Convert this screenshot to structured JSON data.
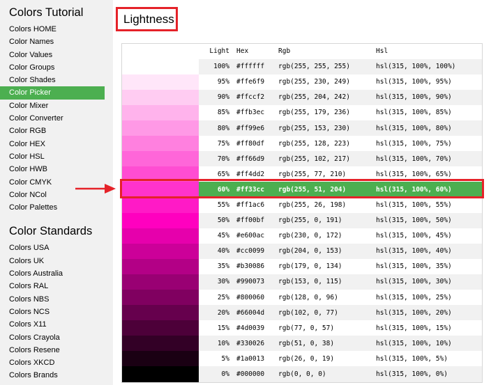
{
  "sidebar": {
    "tutorial_heading": "Colors Tutorial",
    "tutorial_items": [
      "Colors HOME",
      "Color Names",
      "Color Values",
      "Color Groups",
      "Color Shades",
      "Color Picker",
      "Color Mixer",
      "Color Converter",
      "Color RGB",
      "Color HEX",
      "Color HSL",
      "Color HWB",
      "Color CMYK",
      "Color NCol",
      "Color Palettes"
    ],
    "active_item": "Color Picker",
    "standards_heading": "Color Standards",
    "standards_items": [
      "Colors USA",
      "Colors UK",
      "Colors Australia",
      "Colors RAL",
      "Colors NBS",
      "Colors NCS",
      "Colors X11",
      "Colors Crayola",
      "Colors Resene",
      "Colors XKCD",
      "Colors Brands"
    ]
  },
  "main": {
    "title": "Lightness",
    "table": {
      "headers": {
        "light": "Light",
        "hex": "Hex",
        "rgb": "Rgb",
        "hsl": "Hsl"
      },
      "selected_index": 8,
      "rows": [
        {
          "light": "100%",
          "hex": "#ffffff",
          "rgb": "rgb(255, 255, 255)",
          "hsl": "hsl(315, 100%, 100%)",
          "swatch": "#ffffff"
        },
        {
          "light": "95%",
          "hex": "#ffe6f9",
          "rgb": "rgb(255, 230, 249)",
          "hsl": "hsl(315, 100%, 95%)",
          "swatch": "#ffe6f9"
        },
        {
          "light": "90%",
          "hex": "#ffccf2",
          "rgb": "rgb(255, 204, 242)",
          "hsl": "hsl(315, 100%, 90%)",
          "swatch": "#ffccf2"
        },
        {
          "light": "85%",
          "hex": "#ffb3ec",
          "rgb": "rgb(255, 179, 236)",
          "hsl": "hsl(315, 100%, 85%)",
          "swatch": "#ffb3ec"
        },
        {
          "light": "80%",
          "hex": "#ff99e6",
          "rgb": "rgb(255, 153, 230)",
          "hsl": "hsl(315, 100%, 80%)",
          "swatch": "#ff99e6"
        },
        {
          "light": "75%",
          "hex": "#ff80df",
          "rgb": "rgb(255, 128, 223)",
          "hsl": "hsl(315, 100%, 75%)",
          "swatch": "#ff80df"
        },
        {
          "light": "70%",
          "hex": "#ff66d9",
          "rgb": "rgb(255, 102, 217)",
          "hsl": "hsl(315, 100%, 70%)",
          "swatch": "#ff66d9"
        },
        {
          "light": "65%",
          "hex": "#ff4dd2",
          "rgb": "rgb(255, 77, 210)",
          "hsl": "hsl(315, 100%, 65%)",
          "swatch": "#ff4dd2"
        },
        {
          "light": "60%",
          "hex": "#ff33cc",
          "rgb": "rgb(255, 51, 204)",
          "hsl": "hsl(315, 100%, 60%)",
          "swatch": "#ff33cc"
        },
        {
          "light": "55%",
          "hex": "#ff1ac6",
          "rgb": "rgb(255, 26, 198)",
          "hsl": "hsl(315, 100%, 55%)",
          "swatch": "#ff1ac6"
        },
        {
          "light": "50%",
          "hex": "#ff00bf",
          "rgb": "rgb(255, 0, 191)",
          "hsl": "hsl(315, 100%, 50%)",
          "swatch": "#ff00bf"
        },
        {
          "light": "45%",
          "hex": "#e600ac",
          "rgb": "rgb(230, 0, 172)",
          "hsl": "hsl(315, 100%, 45%)",
          "swatch": "#e600ac"
        },
        {
          "light": "40%",
          "hex": "#cc0099",
          "rgb": "rgb(204, 0, 153)",
          "hsl": "hsl(315, 100%, 40%)",
          "swatch": "#cc0099"
        },
        {
          "light": "35%",
          "hex": "#b30086",
          "rgb": "rgb(179, 0, 134)",
          "hsl": "hsl(315, 100%, 35%)",
          "swatch": "#b30086"
        },
        {
          "light": "30%",
          "hex": "#990073",
          "rgb": "rgb(153, 0, 115)",
          "hsl": "hsl(315, 100%, 30%)",
          "swatch": "#990073"
        },
        {
          "light": "25%",
          "hex": "#800060",
          "rgb": "rgb(128, 0, 96)",
          "hsl": "hsl(315, 100%, 25%)",
          "swatch": "#800060"
        },
        {
          "light": "20%",
          "hex": "#66004d",
          "rgb": "rgb(102, 0, 77)",
          "hsl": "hsl(315, 100%, 20%)",
          "swatch": "#66004d"
        },
        {
          "light": "15%",
          "hex": "#4d0039",
          "rgb": "rgb(77, 0, 57)",
          "hsl": "hsl(315, 100%, 15%)",
          "swatch": "#4d0039"
        },
        {
          "light": "10%",
          "hex": "#330026",
          "rgb": "rgb(51, 0, 38)",
          "hsl": "hsl(315, 100%, 10%)",
          "swatch": "#330026"
        },
        {
          "light": "5%",
          "hex": "#1a0013",
          "rgb": "rgb(26, 0, 19)",
          "hsl": "hsl(315, 100%, 5%)",
          "swatch": "#1a0013"
        },
        {
          "light": "0%",
          "hex": "#000000",
          "rgb": "rgb(0, 0, 0)",
          "hsl": "hsl(315, 100%, 0%)",
          "swatch": "#000000"
        }
      ]
    }
  },
  "colors": {
    "accent_green": "#4caf50",
    "annotation_red": "#e52229",
    "sidebar_bg": "#f1f1f1"
  },
  "icons": {
    "annotation_arrow": "arrow-right-icon"
  }
}
